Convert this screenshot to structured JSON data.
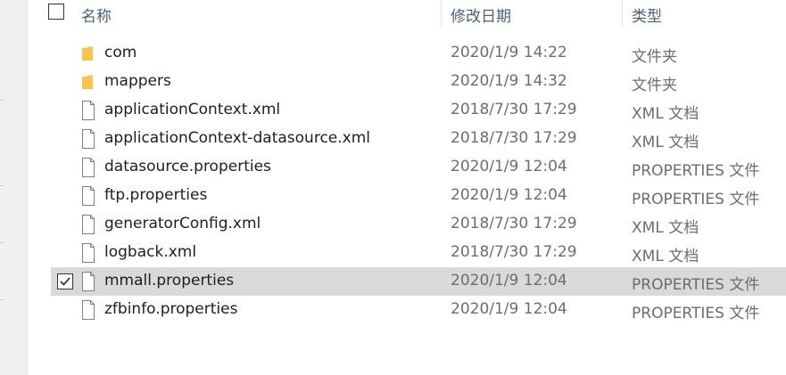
{
  "header": {
    "col_name": "名称",
    "col_date": "修改日期",
    "col_type": "类型"
  },
  "files": [
    {
      "name": "com",
      "date": "2020/1/9 14:22",
      "type": "文件夹",
      "icon": "folder-icon",
      "selected": false
    },
    {
      "name": "mappers",
      "date": "2020/1/9 14:32",
      "type": "文件夹",
      "icon": "folder-icon",
      "selected": false
    },
    {
      "name": "applicationContext.xml",
      "date": "2018/7/30 17:29",
      "type": "XML 文档",
      "icon": "file-icon",
      "selected": false
    },
    {
      "name": "applicationContext-datasource.xml",
      "date": "2018/7/30 17:29",
      "type": "XML 文档",
      "icon": "file-icon",
      "selected": false
    },
    {
      "name": "datasource.properties",
      "date": "2020/1/9 12:04",
      "type": "PROPERTIES 文件",
      "icon": "file-icon",
      "selected": false
    },
    {
      "name": "ftp.properties",
      "date": "2020/1/9 12:04",
      "type": "PROPERTIES 文件",
      "icon": "file-icon",
      "selected": false
    },
    {
      "name": "generatorConfig.xml",
      "date": "2018/7/30 17:29",
      "type": "XML 文档",
      "icon": "file-icon",
      "selected": false
    },
    {
      "name": "logback.xml",
      "date": "2018/7/30 17:29",
      "type": "XML 文档",
      "icon": "file-icon",
      "selected": false
    },
    {
      "name": "mmall.properties",
      "date": "2020/1/9 12:04",
      "type": "PROPERTIES 文件",
      "icon": "file-icon",
      "selected": true
    },
    {
      "name": "zfbinfo.properties",
      "date": "2020/1/9 12:04",
      "type": "PROPERTIES 文件",
      "icon": "file-icon",
      "selected": false
    }
  ],
  "colors": {
    "folder": "#f8c44a",
    "selection": "#d9d9d9",
    "header_text": "#4c607a"
  }
}
